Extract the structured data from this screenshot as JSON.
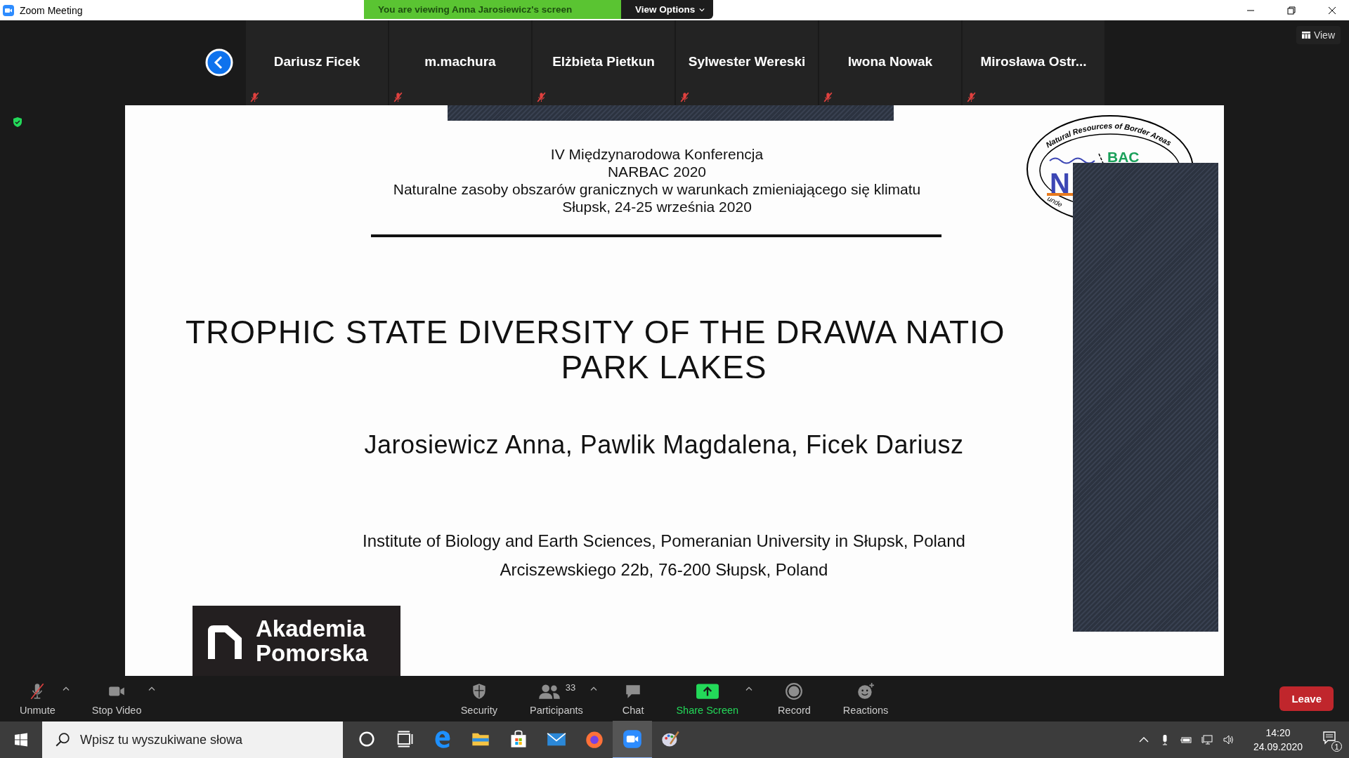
{
  "window": {
    "title": "Zoom Meeting"
  },
  "share_banner": {
    "text": "You are viewing Anna Jarosiewicz's screen",
    "options": "View Options"
  },
  "participants": [
    {
      "name": "Dariusz Ficek",
      "muted": true
    },
    {
      "name": "m.machura",
      "muted": true
    },
    {
      "name": "Elżbieta Pietkun",
      "muted": true
    },
    {
      "name": "Sylwester Wereski",
      "muted": true
    },
    {
      "name": "Iwona Nowak",
      "muted": true
    },
    {
      "name": "Mirosława  Ostr...",
      "muted": true
    }
  ],
  "view_button": "View",
  "slide": {
    "header_lines": [
      "IV Międzynarodowa Konferencja",
      "NARBAC 2020",
      "Naturalne zasoby obszarów granicznych w warunkach zmieniającego się klimatu",
      "Słupsk, 24-25 września 2020"
    ],
    "title_lines": [
      "TROPHIC STATE DIVERSITY OF THE DRAWA NATIO",
      "PARK LAKES"
    ],
    "authors": "Jarosiewicz Anna, Pawlik Magdalena, Ficek Dariusz",
    "affiliation_lines": [
      "Institute of Biology and Earth Sciences, Pomeranian University in Słupsk, Poland",
      "Arciszewskiego 22b, 76-200 Słupsk, Poland"
    ],
    "conference_logo": {
      "ring_text": "Natural Resources of Border Areas",
      "left": "N",
      "right": "BAC",
      "bottom": "unde"
    },
    "university_logo": [
      "Akademia",
      "Pomorska"
    ]
  },
  "toolbar": {
    "left": [
      {
        "label": "Unmute",
        "kind": "mic",
        "menu": true
      },
      {
        "label": "Stop Video",
        "kind": "video",
        "menu": true
      }
    ],
    "center": [
      {
        "label": "Security",
        "kind": "security",
        "menu": false
      },
      {
        "label": "Participants",
        "kind": "participants",
        "count": "33",
        "menu": true
      },
      {
        "label": "Chat",
        "kind": "chat",
        "menu": false
      },
      {
        "label": "Share Screen",
        "kind": "share",
        "menu": true
      },
      {
        "label": "Record",
        "kind": "record",
        "menu": false
      },
      {
        "label": "Reactions",
        "kind": "reactions",
        "menu": false
      }
    ],
    "leave": "Leave"
  },
  "taskbar": {
    "search": {
      "placeholder": "Wpisz tu wyszukiwane słowa"
    },
    "time": "14:20",
    "date": "24.09.2020",
    "notifications": "1"
  }
}
